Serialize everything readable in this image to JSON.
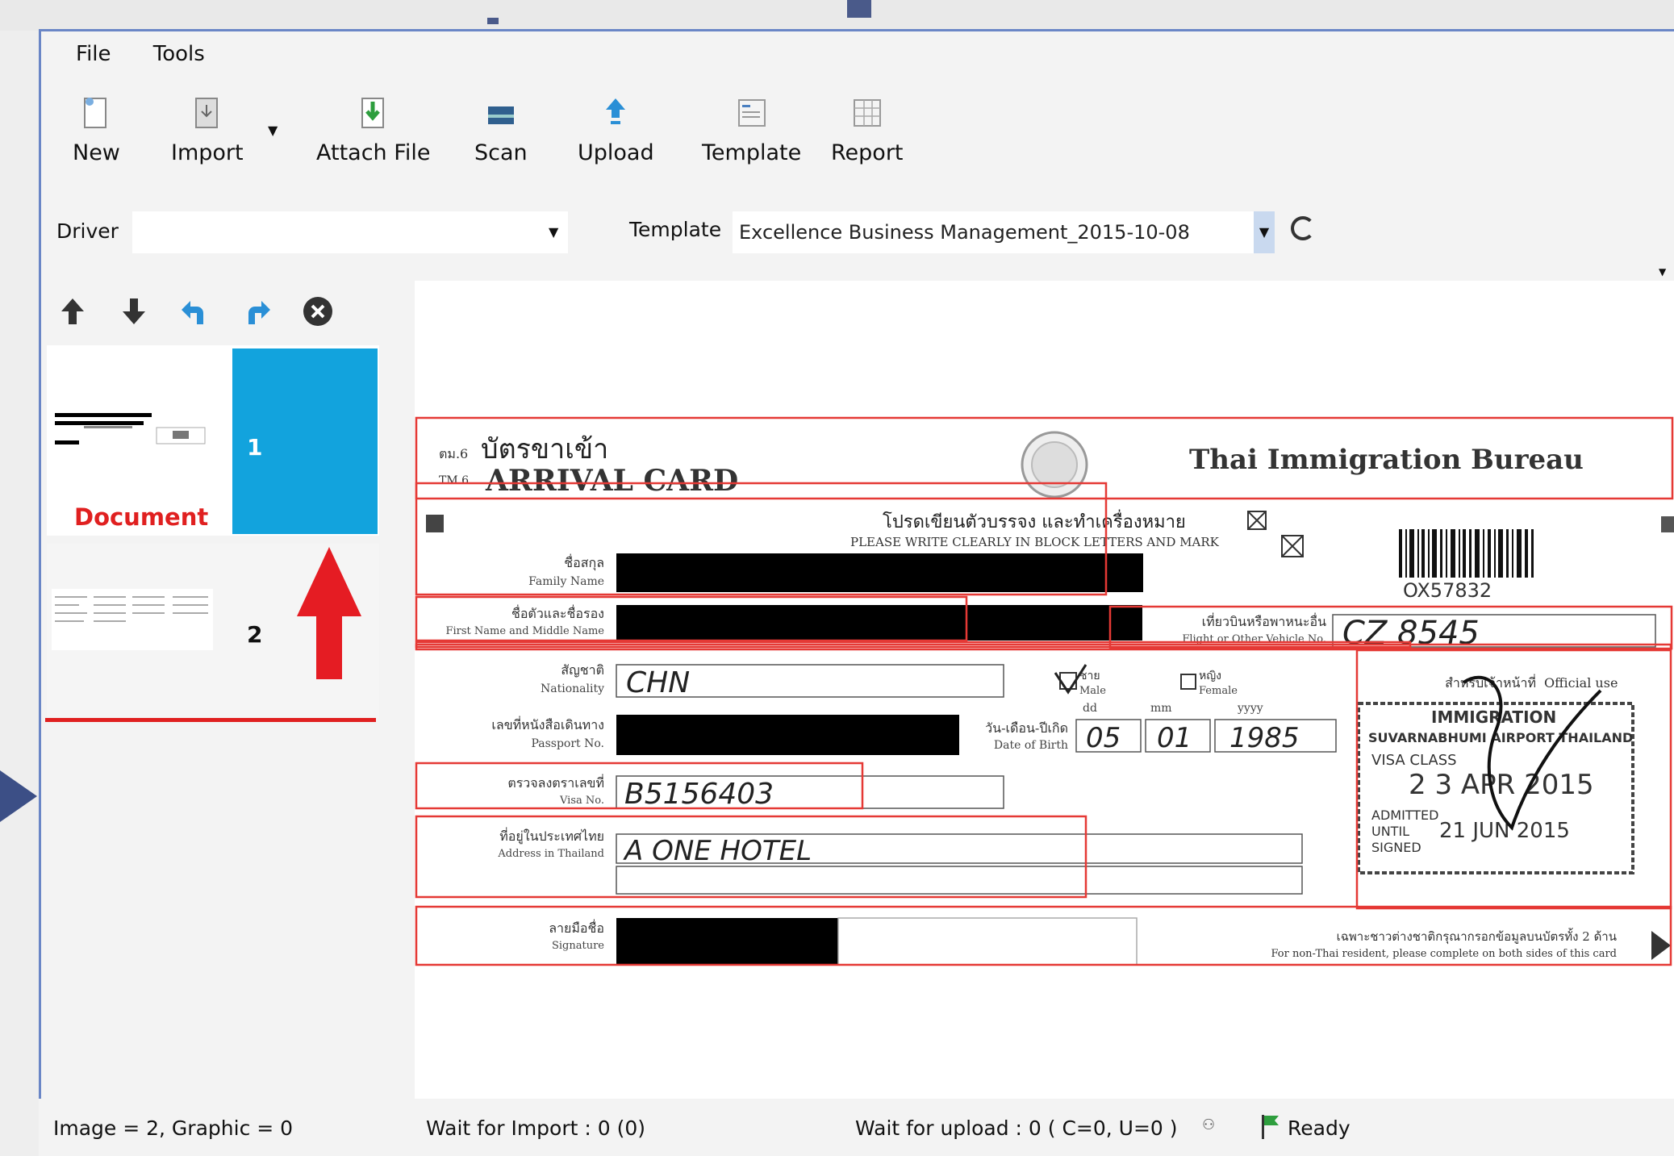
{
  "menu": {
    "file": "File",
    "tools": "Tools"
  },
  "toolbar": {
    "new": "New",
    "import": "Import",
    "attach": "Attach File",
    "scan": "Scan",
    "upload": "Upload",
    "template": "Template",
    "report": "Report"
  },
  "options": {
    "driver_label": "Driver",
    "driver_value": "",
    "template_label": "Template",
    "template_value": "Excellence Business Management_2015-10-08"
  },
  "pages": [
    {
      "number": "1",
      "label": "Document"
    },
    {
      "number": "2",
      "label": ""
    }
  ],
  "card": {
    "tm_code1": "ตม.6",
    "title_thai": "บัตรขาเข้า",
    "tm_code2": "TM.6",
    "title_en": "ARRIVAL CARD",
    "bureau": "Thai Immigration Bureau",
    "instruction_thai": "โปรดเขียนตัวบรรจง และทำเครื่องหมาย",
    "instruction_en": "PLEASE WRITE CLEARLY IN BLOCK LETTERS AND MARK",
    "barcode_number": "OX57832",
    "family_name_thai": "ชื่อสกุล",
    "family_name_en": "Family Name",
    "first_name_thai": "ชื่อตัวและชื่อรอง",
    "first_name_en": "First Name and Middle Name",
    "flight_thai": "เที่ยวบินหรือพาหนะอื่น",
    "flight_en": "Flight or Other Vehicle No.",
    "flight_value": "CZ 8545",
    "nationality_thai": "สัญชาติ",
    "nationality_en": "Nationality",
    "nationality_value": "CHN",
    "male_thai": "ชาย",
    "male_en": "Male",
    "female_thai": "หญิง",
    "female_en": "Female",
    "dd": "dd",
    "mm": "mm",
    "yyyy": "yyyy",
    "passport_thai": "เลขที่หนังสือเดินทาง",
    "passport_en": "Passport No.",
    "dob_thai": "วัน-เดือน-ปีเกิด",
    "dob_en": "Date of Birth",
    "dob_day": "05",
    "dob_month": "01",
    "dob_year": "1985",
    "visa_thai": "ตรวจลงตราเลขที่",
    "visa_en": "Visa No.",
    "visa_value": "B5156403",
    "address_thai": "ที่อยู่ในประเทศไทย",
    "address_en": "Address in Thailand",
    "address_value": "A ONE HOTEL",
    "signature_thai": "ลายมือชื่อ",
    "signature_en": "Signature",
    "official_thai": "สำหรับเจ้าหน้าที่",
    "official_en": "Official use",
    "stamp_immigration": "IMMIGRATION",
    "stamp_airport": "SUVARNABHUMI AIRPORT THAILAND",
    "stamp_visa_class": "VISA CLASS",
    "stamp_date": "2 3 APR 2015",
    "stamp_admitted": "ADMITTED",
    "stamp_until": "UNTIL",
    "stamp_until_date": "21 JUN 2015",
    "stamp_signed": "SIGNED",
    "footer_thai": "เฉพาะชาวต่างชาติกรุณากรอกข้อมูลบนบัตรทั้ง 2 ด้าน",
    "footer_en": "For non-Thai resident, please complete on both sides of this card"
  },
  "status": {
    "images": "Image = 2, Graphic = 0",
    "import": "Wait for Import : 0 (0)",
    "upload": "Wait for upload : 0 ( C=0, U=0 )",
    "ready": "Ready"
  },
  "colors": {
    "selection": "#12a3dd",
    "accent_red": "#e02020",
    "frame_border": "#6a86c6",
    "field_box": "#e53935"
  }
}
